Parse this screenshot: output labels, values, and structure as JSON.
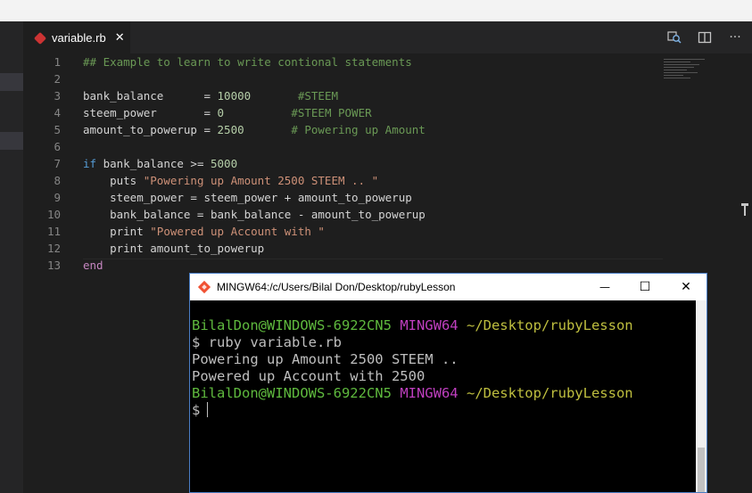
{
  "editor": {
    "tab": {
      "label": "variable.rb",
      "close_glyph": "✕",
      "icon": "ruby-file-icon"
    },
    "actions": {
      "open_preview_icon": "search-preview-icon",
      "split_icon": "split-editor-icon",
      "more_glyph": "···"
    },
    "line_numbers": [
      "1",
      "2",
      "3",
      "4",
      "5",
      "6",
      "7",
      "8",
      "9",
      "10",
      "11",
      "12",
      "13"
    ],
    "lines": [
      [
        {
          "t": "## Example to learn to write contional statements",
          "c": "c"
        }
      ],
      [],
      [
        {
          "t": "bank_balance      = "
        },
        {
          "t": "10000",
          "c": "n"
        },
        {
          "t": "       "
        },
        {
          "t": "#STEEM",
          "c": "c"
        }
      ],
      [
        {
          "t": "steem_power       = "
        },
        {
          "t": "0",
          "c": "n"
        },
        {
          "t": "          "
        },
        {
          "t": "#STEEM POWER",
          "c": "c"
        }
      ],
      [
        {
          "t": "amount_to_powerup = "
        },
        {
          "t": "2500",
          "c": "n"
        },
        {
          "t": "       "
        },
        {
          "t": "# Powering up Amount",
          "c": "c"
        }
      ],
      [],
      [
        {
          "t": "if",
          "c": "k"
        },
        {
          "t": " bank_balance >= "
        },
        {
          "t": "5000",
          "c": "n"
        }
      ],
      [
        {
          "t": "    puts "
        },
        {
          "t": "\"Powering up Amount 2500 STEEM .. \"",
          "c": "s"
        }
      ],
      [
        {
          "t": "    steem_power = steem_power + amount_to_powerup"
        }
      ],
      [
        {
          "t": "    bank_balance = bank_balance - amount_to_powerup"
        }
      ],
      [
        {
          "t": "    print "
        },
        {
          "t": "\"Powered up Account with \"",
          "c": "s"
        }
      ],
      [
        {
          "t": "    print amount_to_powerup"
        }
      ],
      [
        {
          "t": "end",
          "c": "kw"
        }
      ]
    ]
  },
  "terminal": {
    "title": "MINGW64:/c/Users/Bilal Don/Desktop/rubyLesson",
    "minimize_glyph": "—",
    "maximize_glyph": "☐",
    "close_glyph": "✕",
    "lines": [
      [],
      [
        {
          "t": "BilalDon@WINDOWS-6922CN5",
          "c": "green"
        },
        {
          "t": " "
        },
        {
          "t": "MINGW64",
          "c": "magenta"
        },
        {
          "t": " "
        },
        {
          "t": "~/Desktop/rubyLesson",
          "c": "yellow"
        }
      ],
      [
        {
          "t": "$ ruby variable.rb"
        }
      ],
      [
        {
          "t": "Powering up Amount 2500 STEEM .."
        }
      ],
      [
        {
          "t": "Powered up Account with 2500"
        }
      ],
      [
        {
          "t": "BilalDon@WINDOWS-6922CN5",
          "c": "green"
        },
        {
          "t": " "
        },
        {
          "t": "MINGW64",
          "c": "magenta"
        },
        {
          "t": " "
        },
        {
          "t": "~/Desktop/rubyLesson",
          "c": "yellow"
        }
      ],
      [
        {
          "t": "$",
          "cursor": true
        }
      ]
    ]
  },
  "colors": {
    "editor_bg": "#1e1e1e",
    "comment": "#6a9955",
    "number": "#b5cea8",
    "keyword": "#569cd6",
    "string": "#ce9178",
    "prompt_user": "#5fba3e",
    "prompt_mingw": "#bf3fbf",
    "prompt_path": "#bfbf3f"
  }
}
